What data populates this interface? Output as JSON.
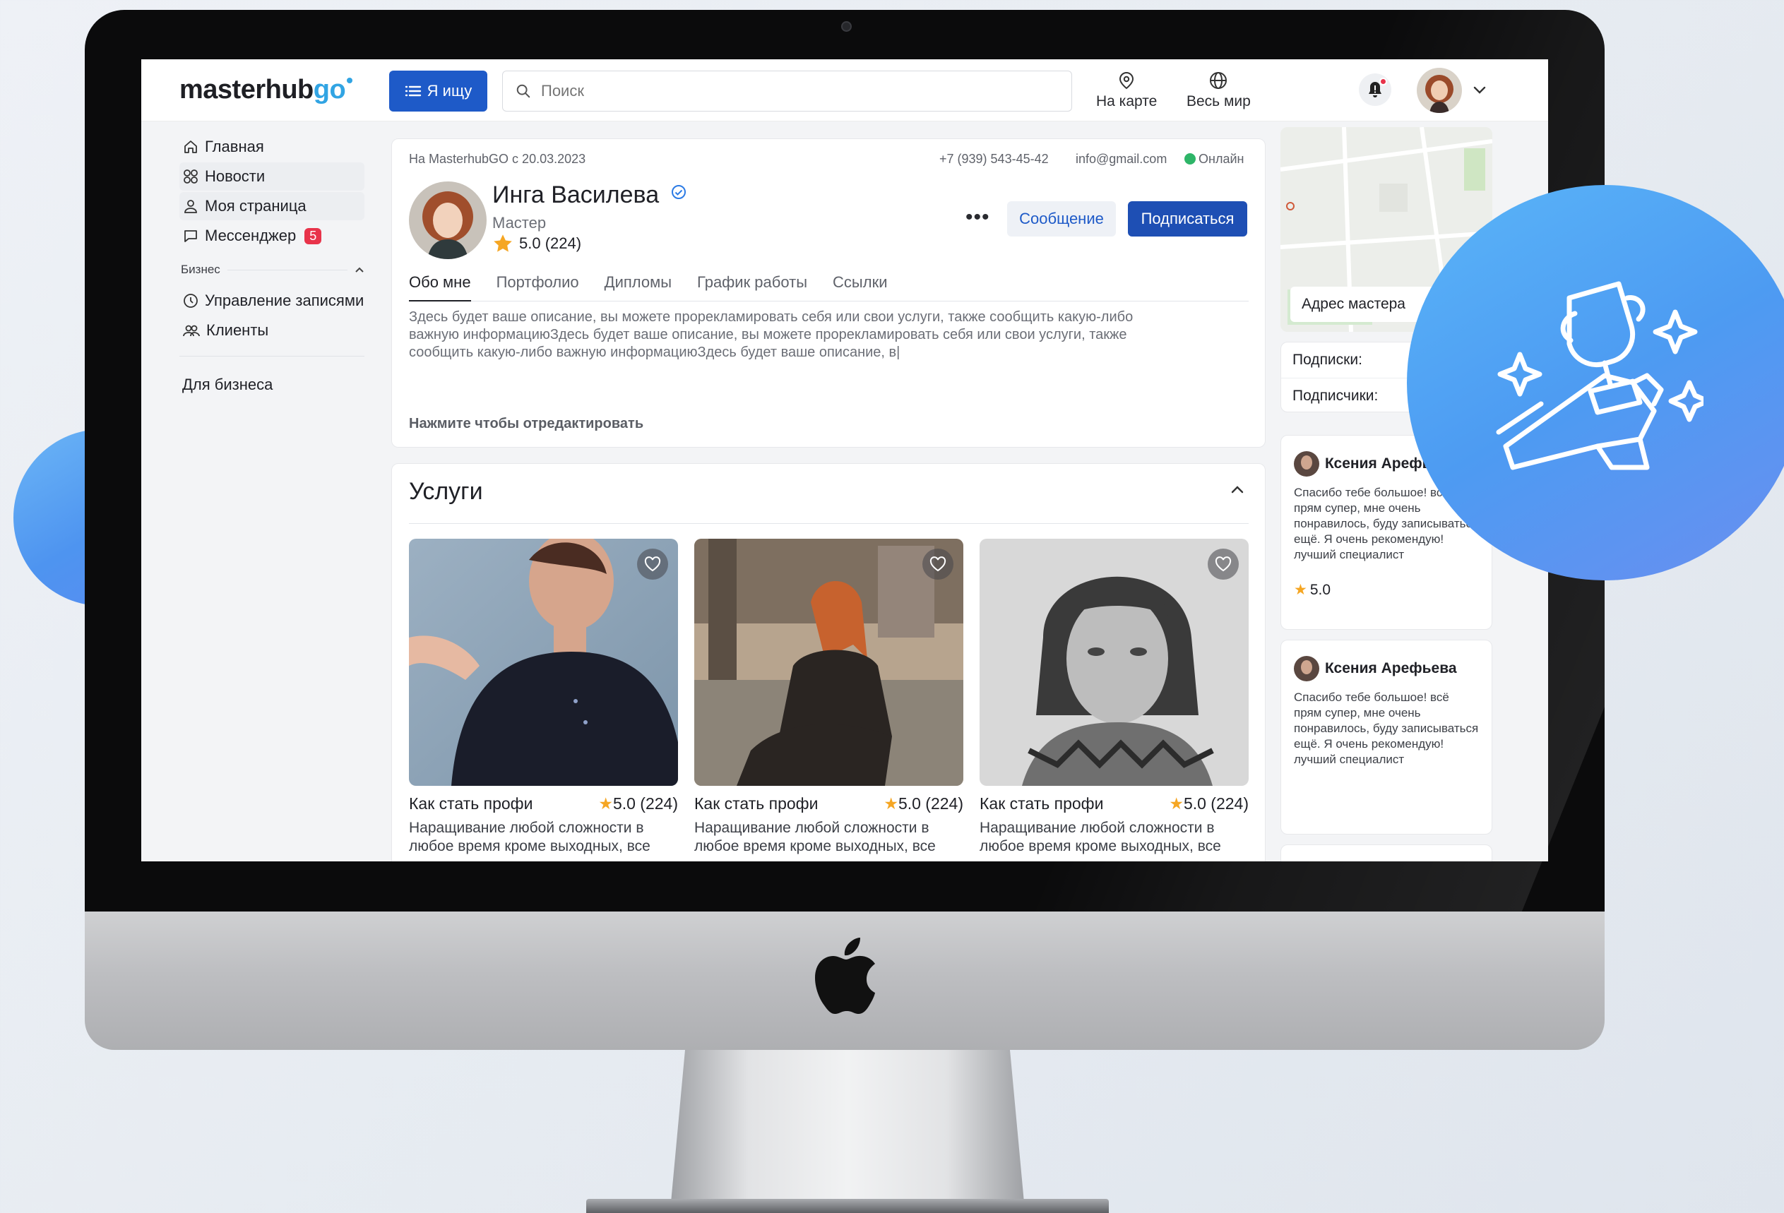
{
  "app": {
    "logo_main": "masterhub",
    "logo_accent": "go",
    "seek_button": "Я ищу"
  },
  "search": {
    "placeholder": "Поиск"
  },
  "topnav": {
    "map": "На карте",
    "world": "Весь мир"
  },
  "sidebar": {
    "items": [
      {
        "label": "Главная",
        "icon": "home-icon"
      },
      {
        "label": "Новости",
        "icon": "grid-icon"
      },
      {
        "label": "Моя страница",
        "icon": "user-icon"
      },
      {
        "label": "Мессенджер",
        "icon": "chat-icon",
        "badge": "5"
      }
    ],
    "business_section": "Бизнес",
    "business_items": [
      {
        "label": "Управление записями",
        "icon": "clock-icon"
      },
      {
        "label": "Клиенты",
        "icon": "clients-icon"
      }
    ],
    "for_business": "Для бизнеса"
  },
  "profile": {
    "since": "На MasterhubGO с 20.03.2023",
    "phone": "+7 (939) 543-45-42",
    "email": "info@gmail.com",
    "status": "Онлайн",
    "name": "Инга Василева",
    "role": "Мастер",
    "rating": "5.0 (224)",
    "message_button": "Сообщение",
    "subscribe_button": "Подписаться",
    "tabs": [
      "Обо мне",
      "Портфолио",
      "Дипломы",
      "График работы",
      "Ссылки"
    ],
    "about": "Здесь будет ваше описание, вы можете прорекламировать себя или свои услуги, также сообщить какую-либо важную информациюЗдесь будет ваше описание, вы можете прорекламировать себя или свои услуги, также сообщить какую-либо важную информациюЗдесь будет ваше описание, в|",
    "edit_hint": "Нажмите чтобы отредактировать"
  },
  "services": {
    "title": "Услуги",
    "items": [
      {
        "title": "Как стать профи",
        "rating": "5.0 (224)",
        "desc_1": "Наращивание любой сложности в",
        "desc_2": "любое время кроме выходных, все"
      },
      {
        "title": "Как стать профи",
        "rating": "5.0 (224)",
        "desc_1": "Наращивание любой сложности в",
        "desc_2": "любое время кроме выходных, все"
      },
      {
        "title": "Как стать профи",
        "rating": "5.0 (224)",
        "desc_1": "Наращивание любой сложности в",
        "desc_2": "любое время кроме выходных, все"
      }
    ]
  },
  "right": {
    "map_label": "Адрес мастера",
    "subscriptions": "Подписки:",
    "subscribers": "Подписчики:",
    "reviews": [
      {
        "name": "Ксения Арефьева",
        "text": "Спасибо тебе большое! всё прям супер, мне очень понравилось, буду записываться ещё. Я очень рекомендую! лучший специалист",
        "rating": "5.0"
      },
      {
        "name": "Ксения Арефьева",
        "text": "Спасибо тебе большое! всё прям супер, мне очень понравилось, буду записываться ещё. Я очень рекомендую! лучший специалист"
      }
    ]
  },
  "colors": {
    "brand": "#1e5ac8",
    "accent": "#31a4e3",
    "badge": "#e8334a",
    "online": "#2eb568",
    "star": "#f5a623"
  }
}
